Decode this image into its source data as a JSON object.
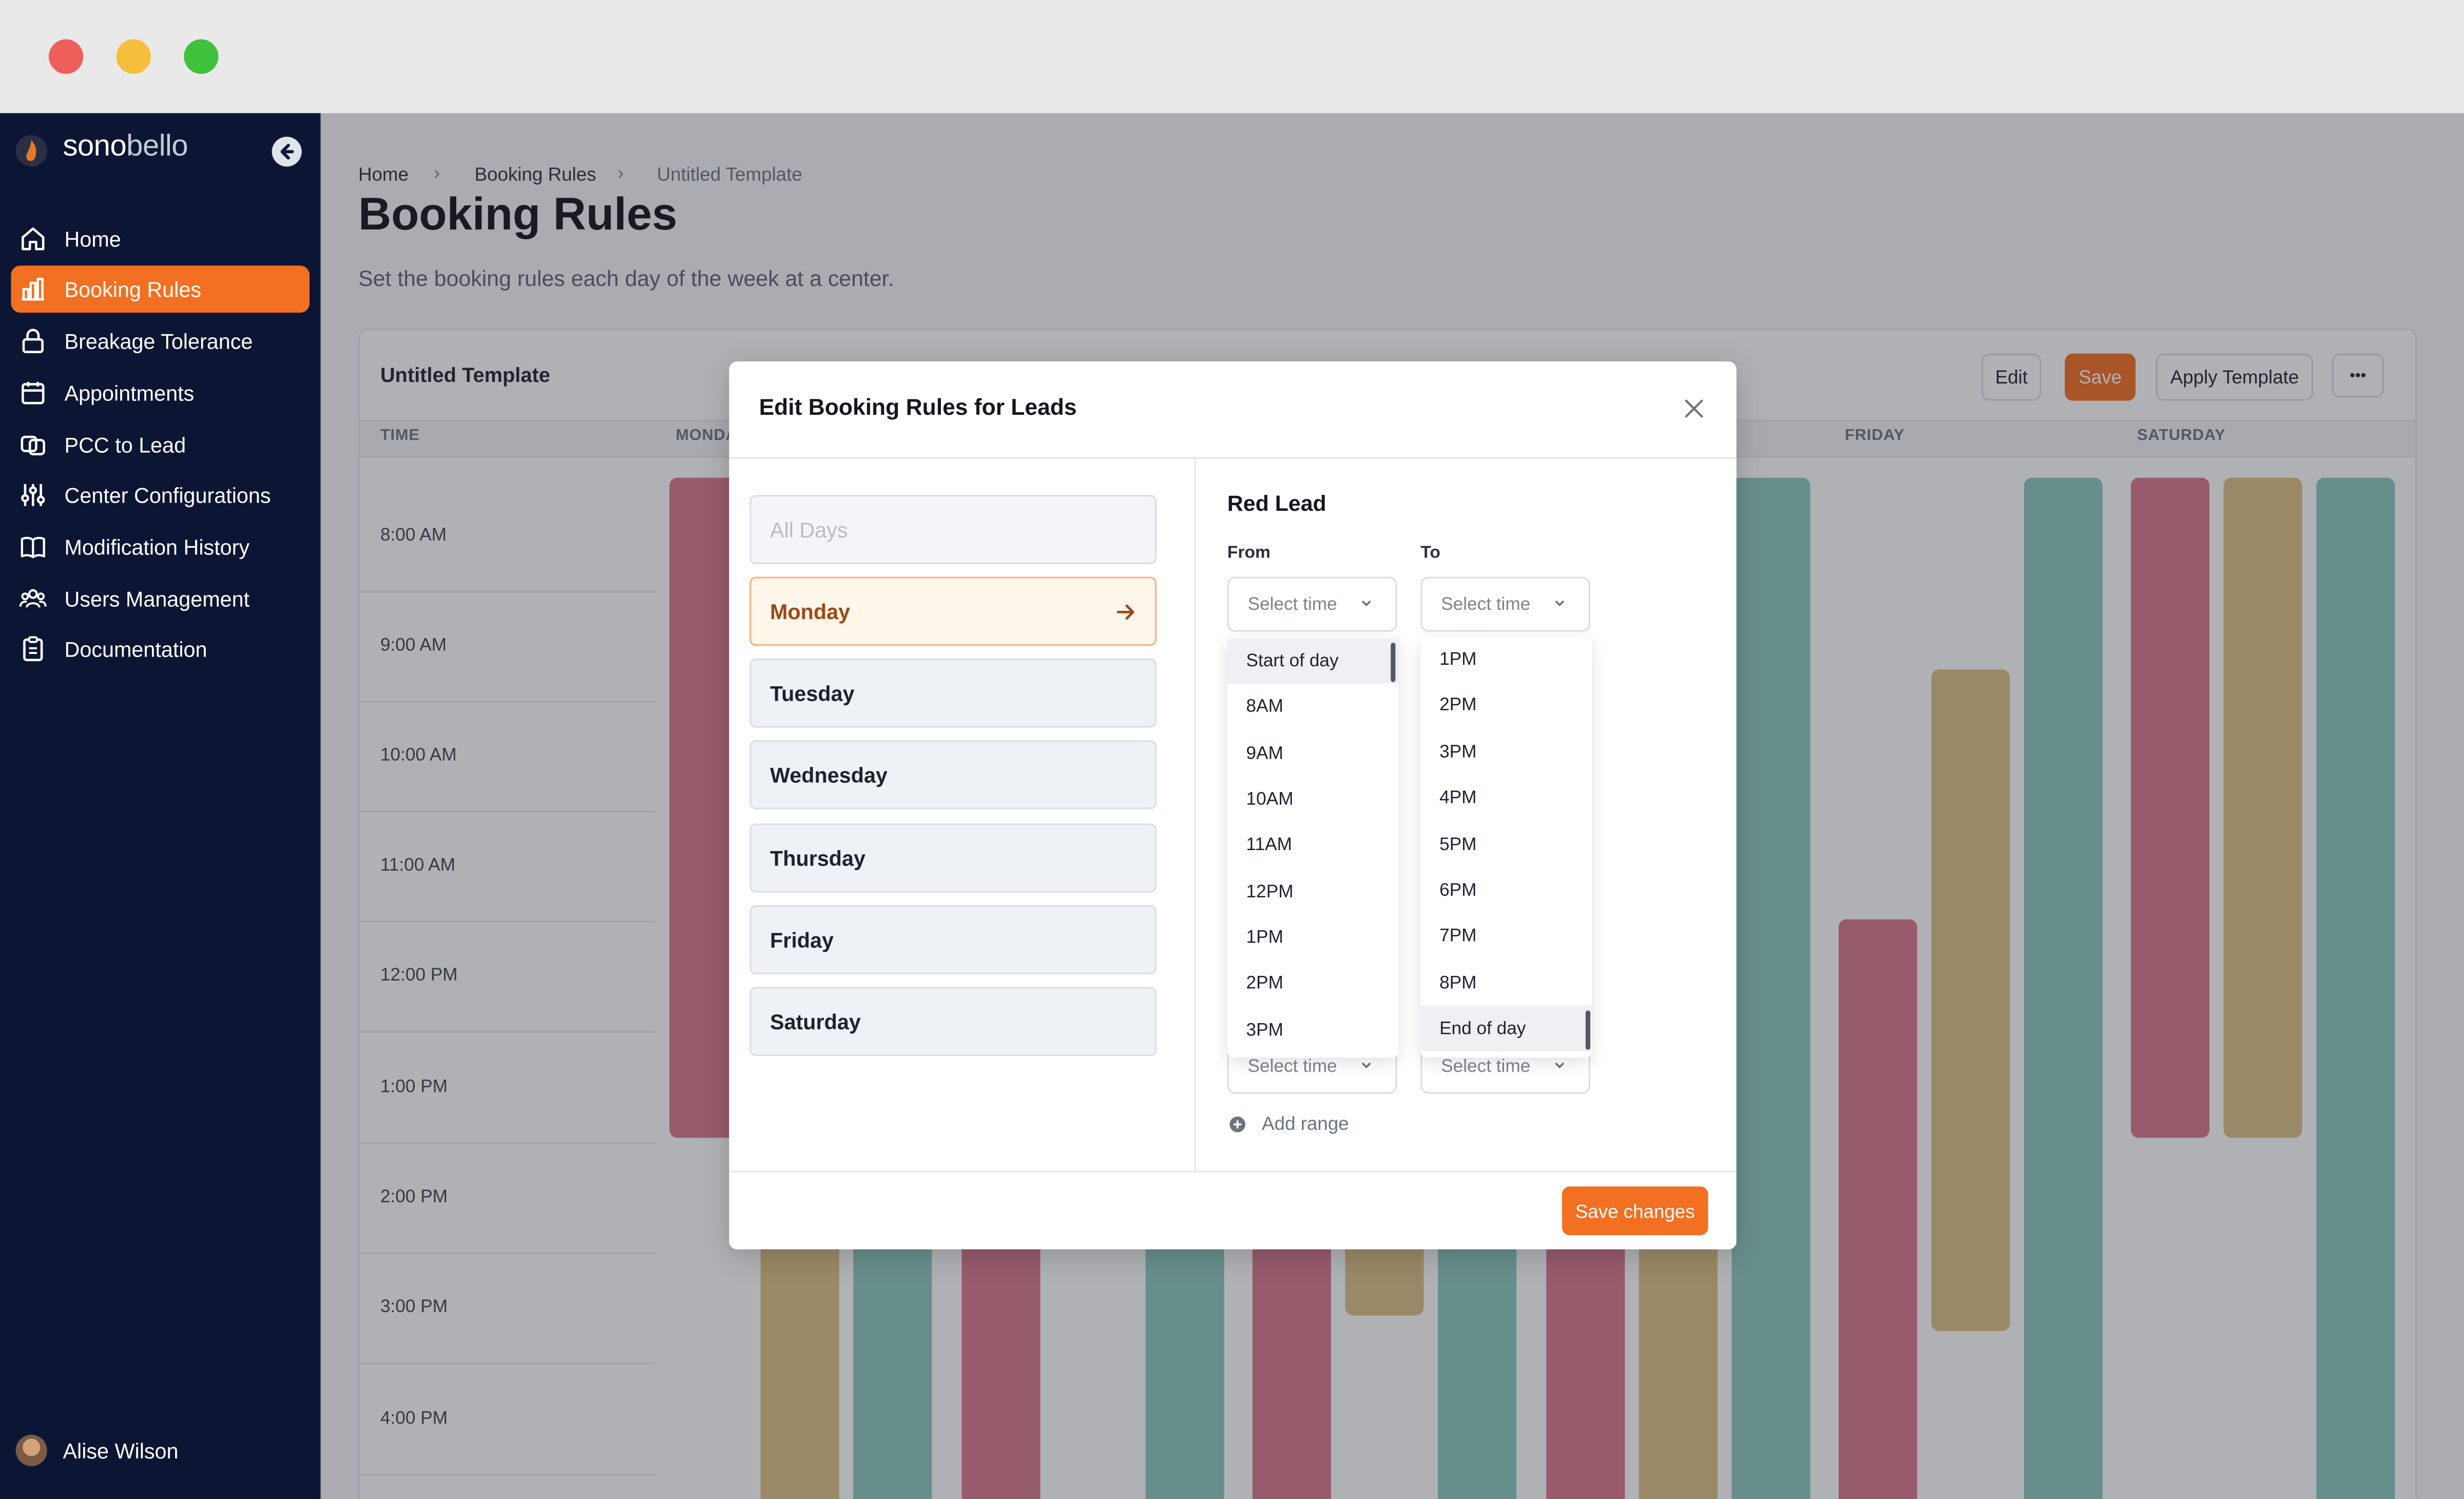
{
  "window": {
    "controls": [
      "close",
      "minimize",
      "maximize"
    ],
    "colors": {
      "close": "#ee5f5b",
      "minimize": "#f7be3b",
      "maximize": "#3ec23e"
    }
  },
  "sidebar": {
    "brand": {
      "name_bold": "sono",
      "name_light": "bello"
    },
    "items": [
      {
        "label": "Home",
        "icon": "home-icon"
      },
      {
        "label": "Booking Rules",
        "icon": "bar-chart-icon",
        "active": true
      },
      {
        "label": "Breakage Tolerance",
        "icon": "lock-icon"
      },
      {
        "label": "Appointments",
        "icon": "calendar-icon"
      },
      {
        "label": "PCC to Lead",
        "icon": "link-icon"
      },
      {
        "label": "Center Configurations",
        "icon": "sliders-icon"
      },
      {
        "label": "Modification History",
        "icon": "book-icon"
      },
      {
        "label": "Users Management",
        "icon": "users-icon"
      },
      {
        "label": "Documentation",
        "icon": "clipboard-icon"
      }
    ],
    "user": {
      "name": "Alise Wilson"
    }
  },
  "breadcrumb": [
    "Home",
    "Booking Rules",
    "Untitled Template"
  ],
  "page": {
    "title": "Booking Rules",
    "subtitle": "Set the booking rules each day of the week at a center."
  },
  "template_card": {
    "title": "Untitled Template",
    "buttons": {
      "edit": "Edit",
      "save": "Save",
      "apply": "Apply Template",
      "more": "•••"
    },
    "columns": {
      "time": "TIME",
      "monday": "MONDA",
      "friday": "FRIDAY",
      "saturday": "SATURDAY"
    },
    "times": [
      "8:00 AM",
      "9:00 AM",
      "10:00 AM",
      "11:00 AM",
      "12:00 PM",
      "1:00 PM",
      "2:00 PM",
      "3:00 PM",
      "4:00 PM"
    ]
  },
  "modal": {
    "title": "Edit Booking Rules for Leads",
    "days": [
      "All Days",
      "Monday",
      "Tuesday",
      "Wednesday",
      "Thursday",
      "Friday",
      "Saturday"
    ],
    "selected_day": "Monday",
    "section_title": "Red Lead",
    "from_label": "From",
    "to_label": "To",
    "select_placeholder": "Select time",
    "from_options": [
      "Start of day",
      "8AM",
      "9AM",
      "10AM",
      "11AM",
      "12PM",
      "1PM",
      "2PM",
      "3PM"
    ],
    "to_options": [
      "1PM",
      "2PM",
      "3PM",
      "4PM",
      "5PM",
      "6PM",
      "7PM",
      "8PM",
      "End of day"
    ],
    "add_range": "Add range",
    "save_changes": "Save changes"
  },
  "colors": {
    "accent": "#f36f21",
    "lead_red": "#d9788c",
    "lead_gold": "#dcc084",
    "lead_teal": "#8bcabf",
    "sidebar_bg": "#0c1634"
  }
}
